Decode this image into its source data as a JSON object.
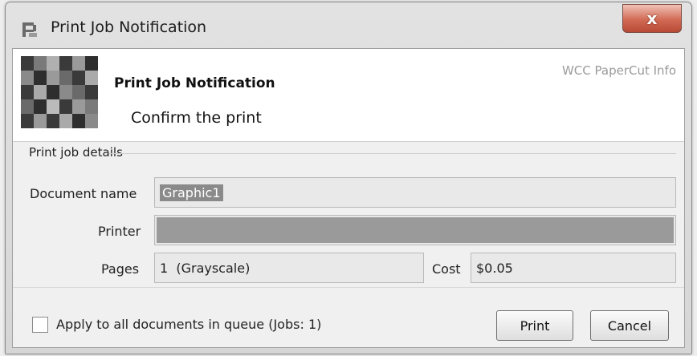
{
  "window": {
    "title": "Print Job Notification",
    "close_symbol": "x"
  },
  "header": {
    "title": "Print Job Notification",
    "subtitle": "Confirm the print",
    "brand": "WCC PaperCut Info"
  },
  "details": {
    "group_label": "Print job details",
    "document_name_label": "Document name",
    "document_name_value": "Graphic1",
    "printer_label": "Printer",
    "printer_value": "",
    "pages_label": "Pages",
    "pages_value": "1  (Grayscale)",
    "cost_label": "Cost",
    "cost_value": "$0.05"
  },
  "footer": {
    "apply_all_label": "Apply to all documents in queue (Jobs: 1)",
    "apply_all_checked": false,
    "print_button": "Print",
    "cancel_button": "Cancel"
  },
  "icons": {
    "app": "printer-notification-icon",
    "logo": "papercut-logo-icon",
    "close": "close-icon"
  },
  "colors": {
    "close_button": "#d16a55",
    "selection": "#8a8a8a"
  }
}
